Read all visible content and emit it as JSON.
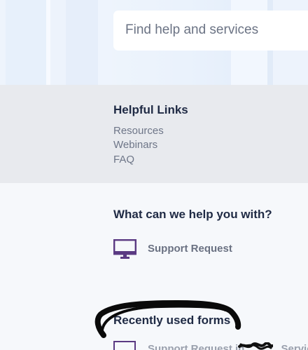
{
  "search": {
    "placeholder": "Find help and services"
  },
  "helpful_links": {
    "title": "Helpful Links",
    "items": [
      {
        "label": "Resources"
      },
      {
        "label": "Webinars"
      },
      {
        "label": "FAQ"
      }
    ]
  },
  "help": {
    "title": "What can we help you with?",
    "items": [
      {
        "label": "Support Request",
        "icon": "monitor-icon"
      }
    ]
  },
  "recent": {
    "title": "Recently used forms",
    "items": [
      {
        "label_start": "Support Request in",
        "label_end": "Service",
        "icon": "monitor-icon"
      }
    ]
  },
  "colors": {
    "accent": "#5b3a83",
    "heading": "#1f2a44",
    "link": "#6e7688",
    "band": "#e8eaee"
  }
}
